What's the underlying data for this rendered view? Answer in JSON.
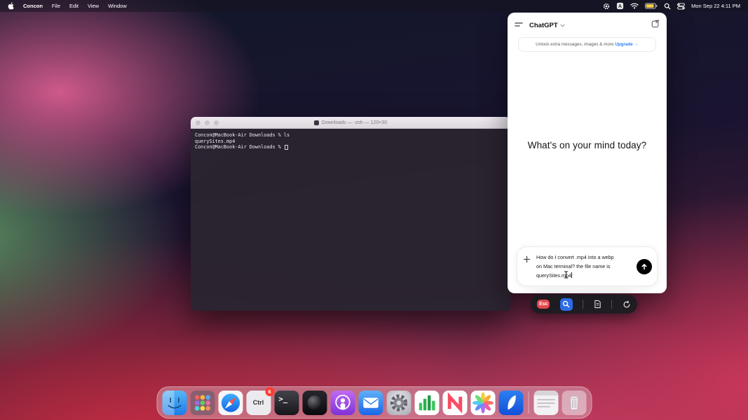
{
  "menu_bar": {
    "app_name": "Concon",
    "menus": [
      "File",
      "Edit",
      "View",
      "Window"
    ],
    "clock": "Mon Sep 22 4:11 PM"
  },
  "terminal": {
    "title": "Downloads — -zsh — 120×30",
    "lines": [
      "Concon@MacBook-Air Downloads % ls",
      "querySites.mp4",
      "Concon@MacBook-Air Downloads % "
    ]
  },
  "chatgpt": {
    "title": "ChatGPT",
    "banner": {
      "text": "Unlock extra messages, images & more",
      "link": "Upgrade →"
    },
    "headline": "What's on your mind today?",
    "composer": {
      "text": "How do I convert .mp4 into a webp on Mac terminal? the file name is querySites.mp4"
    }
  },
  "capture_toolbar": {
    "esc_label": "Esc"
  },
  "dock": {
    "items": [
      {
        "id": "finder"
      },
      {
        "id": "launchpad"
      },
      {
        "id": "safari"
      },
      {
        "id": "ctrl-app",
        "label": "Ctrl",
        "badge": "6"
      },
      {
        "id": "terminal",
        "glyph": ">_"
      },
      {
        "id": "sphere-app"
      },
      {
        "id": "podcasts"
      },
      {
        "id": "mail"
      },
      {
        "id": "system-settings"
      },
      {
        "id": "numbers"
      },
      {
        "id": "news"
      },
      {
        "id": "photos"
      },
      {
        "id": "drafts"
      },
      {
        "id": "minimized-window"
      },
      {
        "id": "trash"
      }
    ]
  }
}
